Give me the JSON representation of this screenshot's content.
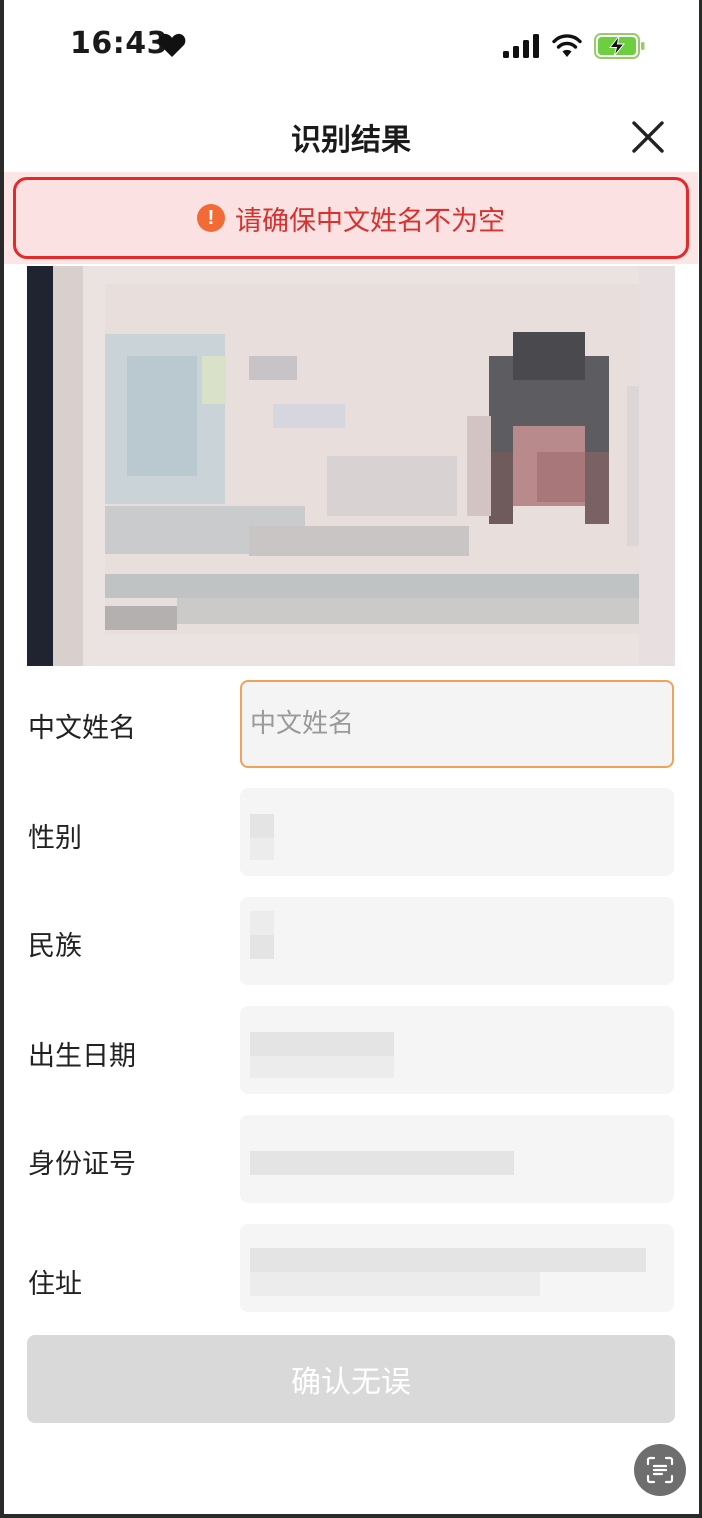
{
  "status_bar": {
    "time": "16:43"
  },
  "nav": {
    "title": "识别结果"
  },
  "alert": {
    "icon": "!",
    "message": "请确保中文姓名不为空"
  },
  "form": {
    "name_label": "中文姓名",
    "name_placeholder": "中文姓名",
    "gender_label": "性别",
    "ethnicity_label": "民族",
    "birth_label": "出生日期",
    "id_number_label": "身份证号",
    "address_label": "住址"
  },
  "confirm_button": "确认无误",
  "colors": {
    "error_red": "#e5282a",
    "banner_bg": "#fbe1e1",
    "warn_orange": "#f26a35",
    "focus_border": "#f0a15a",
    "button_disabled": "#d9d9d9"
  },
  "icons": [
    "heart-icon",
    "signal-icon",
    "wifi-icon",
    "battery-charging-icon",
    "close-icon",
    "warning-icon",
    "scan-text-icon"
  ]
}
